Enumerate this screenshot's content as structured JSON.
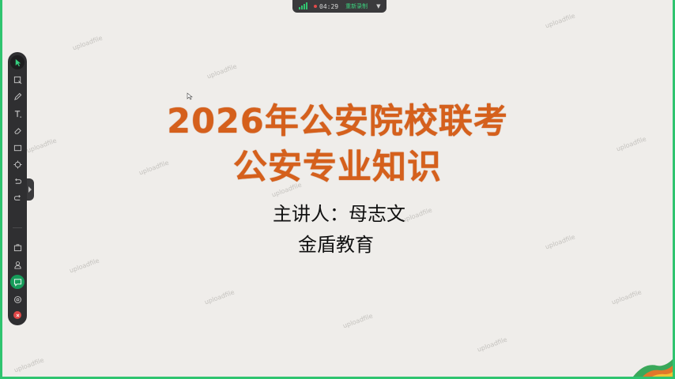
{
  "recording_bar": {
    "time": "04:29",
    "action_label": "重新录制",
    "dropdown_icon": "caret-down-icon",
    "signal_icon": "signal-bars-icon",
    "status_color": "#e24a4a",
    "accent": "#31c46f"
  },
  "toolbar": {
    "tools": [
      {
        "icon": "pointer-icon",
        "active": true
      },
      {
        "icon": "select-icon"
      },
      {
        "icon": "pen-icon"
      },
      {
        "icon": "text-icon"
      },
      {
        "icon": "eraser-icon"
      },
      {
        "icon": "rectangle-icon"
      },
      {
        "icon": "laser-pointer-icon"
      },
      {
        "icon": "undo-icon"
      },
      {
        "icon": "redo-icon"
      },
      {
        "icon": "briefcase-icon"
      },
      {
        "icon": "user-icon"
      },
      {
        "icon": "chat-icon",
        "active": true
      },
      {
        "icon": "settings-icon"
      },
      {
        "icon": "close-icon"
      }
    ]
  },
  "slide": {
    "title_line1": "2026年公安院校联考",
    "title_line2": "公安专业知识",
    "lecturer": "主讲人：母志文",
    "organization": "金盾教育",
    "title_color": "#d5601c"
  },
  "colors": {
    "frame": "#2fc46f",
    "background": "#efedea",
    "toolbar": "#2f2f31"
  }
}
